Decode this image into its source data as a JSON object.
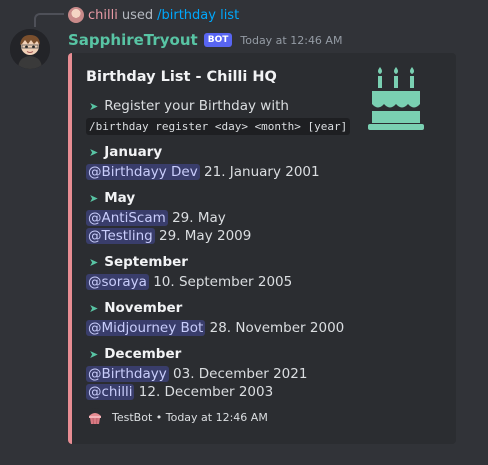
{
  "reply": {
    "user": "chilli",
    "action": "used",
    "command": "/birthday list"
  },
  "message": {
    "username": "SapphireTryout",
    "bot_tag": "BOT",
    "timestamp": "Today at 12:46 AM"
  },
  "embed": {
    "accent_color": "#e88d93",
    "title": "Birthday List - Chilli HQ",
    "thumbnail_icon": "birthday-cake-icon",
    "register_text": "Register your Birthday with",
    "register_command": "/birthday register <day> <month> [year]",
    "months": [
      {
        "name": "January",
        "entries": [
          {
            "mention": "@Birthdayy Dev",
            "date": "21. January 2001"
          }
        ]
      },
      {
        "name": "May",
        "entries": [
          {
            "mention": "@AntiScam",
            "date": "29. May"
          },
          {
            "mention": "@Testling",
            "date": "29. May 2009"
          }
        ]
      },
      {
        "name": "September",
        "entries": [
          {
            "mention": "@soraya",
            "date": "10. September 2005"
          }
        ]
      },
      {
        "name": "November",
        "entries": [
          {
            "mention": "@Midjourney Bot",
            "date": "28. November 2000"
          }
        ]
      },
      {
        "name": "December",
        "entries": [
          {
            "mention": "@Birthdayy",
            "date": "03. December 2021"
          },
          {
            "mention": "@chilli",
            "date": "12. December 2003"
          }
        ]
      }
    ],
    "footer": {
      "text": "TestBot • Today at 12:46 AM",
      "icon": "cupcake-icon"
    }
  }
}
